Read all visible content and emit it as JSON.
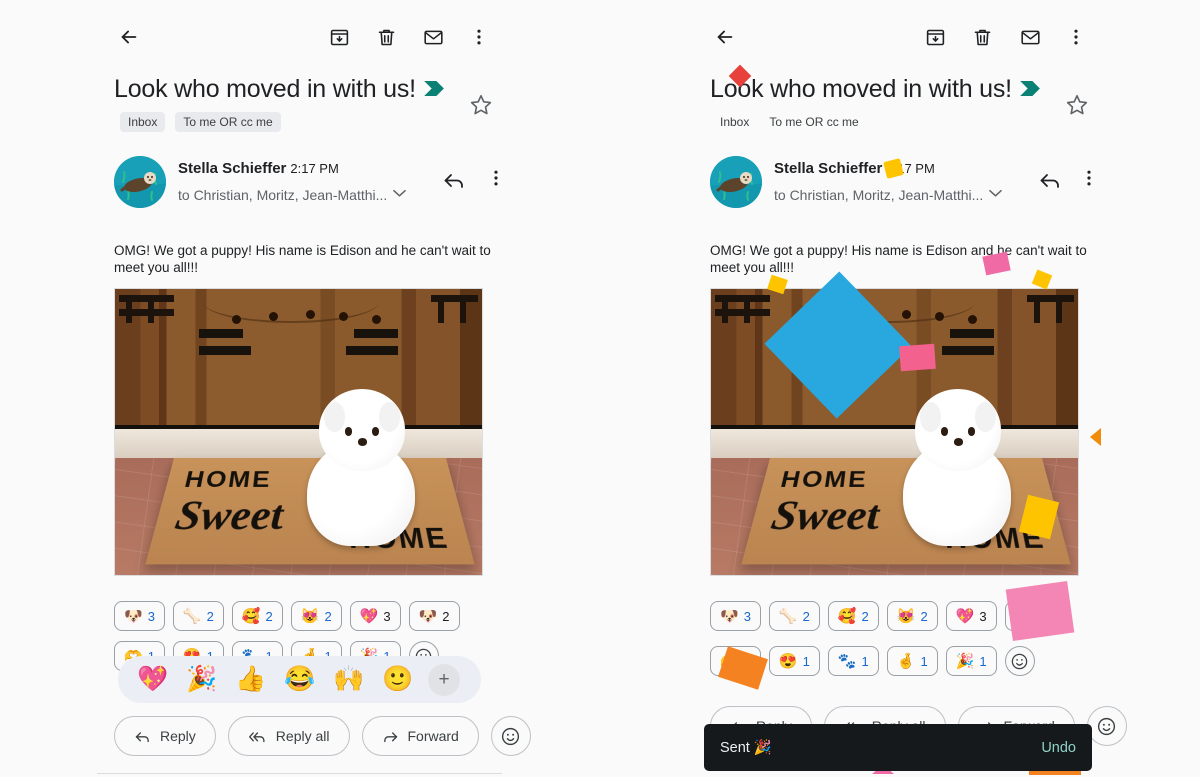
{
  "app": {
    "name": "gmail-conversation-view"
  },
  "toolbar": {
    "back_label": "Back",
    "archive_label": "Archive",
    "delete_label": "Delete",
    "mark_unread_label": "Mark as unread",
    "more_label": "More options"
  },
  "email": {
    "subject": "Look who moved in with us!",
    "labels": [
      "Inbox",
      "To me OR cc me"
    ],
    "star_label": "Star",
    "sender": {
      "name": "Stella Schieffer",
      "time": "2:17 PM",
      "recipients": "to Christian, Moritz, Jean-Matthi...",
      "avatar_label": "otter-avatar"
    },
    "body": "OMG! We got a puppy! His name is Edison and he can't wait to meet you all!!!",
    "attachment": {
      "alt": "White Maltese puppy sitting on a HOME SWEET HOME doormat in front of a wooden door",
      "mat_line1": "HOME",
      "mat_line2": "Sweet",
      "mat_line3": "HOME"
    }
  },
  "reactions": {
    "left_panel": {
      "row1": [
        {
          "emoji": "🐶",
          "count": "3",
          "mine": true,
          "name": "dog-face"
        },
        {
          "emoji": "🦴",
          "count": "2",
          "mine": true,
          "name": "bone"
        },
        {
          "emoji": "🥰",
          "count": "2",
          "mine": true,
          "name": "smiling-face-with-hearts"
        },
        {
          "emoji": "😻",
          "count": "2",
          "mine": true,
          "name": "heart-eyes-cat"
        },
        {
          "emoji": "💖",
          "count": "3",
          "mine": false,
          "name": "sparkling-heart"
        },
        {
          "emoji": "🐶",
          "count": "2",
          "mine": false,
          "name": "dog-face-2"
        }
      ],
      "row2": [
        {
          "emoji": "🫶",
          "count": "1",
          "mine": true,
          "name": "heart-hands"
        },
        {
          "emoji": "😍",
          "count": "1",
          "mine": true,
          "name": "heart-eyes"
        },
        {
          "emoji": "🐾",
          "count": "1",
          "mine": true,
          "name": "paw-prints"
        },
        {
          "emoji": "🤞",
          "count": "1",
          "mine": true,
          "name": "crossed-fingers"
        },
        {
          "emoji": "🎉",
          "count": "1",
          "mine": true,
          "name": "party-popper"
        }
      ]
    },
    "right_panel": {
      "row1": [
        {
          "emoji": "🐶",
          "count": "3",
          "mine": true,
          "name": "dog-face"
        },
        {
          "emoji": "🦴",
          "count": "2",
          "mine": true,
          "name": "bone"
        },
        {
          "emoji": "🥰",
          "count": "2",
          "mine": true,
          "name": "smiling-face-with-hearts"
        },
        {
          "emoji": "😻",
          "count": "2",
          "mine": true,
          "name": "heart-eyes-cat"
        },
        {
          "emoji": "💖",
          "count": "3",
          "mine": false,
          "name": "sparkling-heart"
        },
        {
          "emoji": "🐶",
          "count": "2",
          "mine": false,
          "name": "dog-face-2"
        }
      ],
      "row2": [
        {
          "emoji": "🫶",
          "count": "1",
          "mine": true,
          "name": "heart-hands"
        },
        {
          "emoji": "😍",
          "count": "1",
          "mine": true,
          "name": "heart-eyes"
        },
        {
          "emoji": "🐾",
          "count": "1",
          "mine": true,
          "name": "paw-prints"
        },
        {
          "emoji": "🤞",
          "count": "1",
          "mine": true,
          "name": "crossed-fingers"
        },
        {
          "emoji": "🎉",
          "count": "1",
          "mine": true,
          "name": "party-popper"
        }
      ],
      "add_reaction_label": "Add reaction"
    }
  },
  "emoji_picker": {
    "options": [
      "💖",
      "🎉",
      "👍",
      "😂",
      "🙌",
      "🙂"
    ],
    "more_label": "+"
  },
  "actions": {
    "reply": "Reply",
    "reply_all": "Reply all",
    "forward": "Forward",
    "emoji_label": "React with emoji"
  },
  "toast": {
    "message": "Sent 🎉",
    "undo": "Undo"
  },
  "colors": {
    "accent_teal": "#0b8175",
    "link_blue": "#1967d2",
    "toast_bg": "#16191c",
    "toast_undo": "#8ed3c8",
    "confetti_blue": "#29a8e0",
    "confetti_pink": "#f06aa5",
    "confetti_yellow": "#ffc400",
    "confetti_orange": "#f28a0c",
    "confetti_red": "#e8413c"
  }
}
